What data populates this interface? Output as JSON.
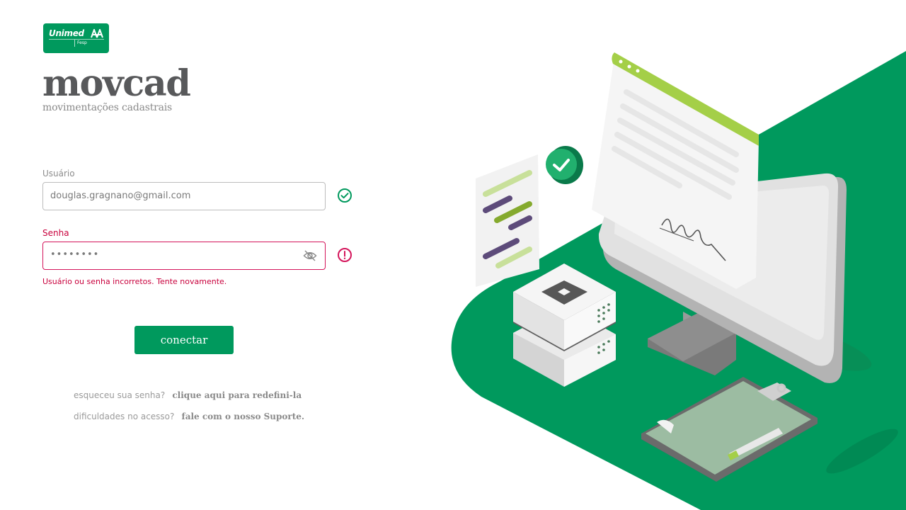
{
  "logo": {
    "brand": "Unimed",
    "region": "Fesp"
  },
  "app": {
    "name": "movcad",
    "tagline": "movimentações cadastrais"
  },
  "form": {
    "user_label": "Usuário",
    "user_value": "douglas.gragnano@gmail.com",
    "password_label": "Senha",
    "password_value": "••••••••",
    "error_message": "Usuário ou senha incorretos. Tente novamente.",
    "submit_label": "conectar"
  },
  "help": {
    "forgot_question": "esqueceu sua senha?",
    "forgot_link": "clique aqui para redefini-la",
    "support_question": "dificuldades no acesso?",
    "support_link": "fale com o nosso Suporte."
  },
  "icons": {
    "user_status": "check-circle-icon",
    "password_status": "alert-circle-icon",
    "password_toggle": "eye-off-icon"
  },
  "colors": {
    "brand_green": "#00995d",
    "error": "#c8003c",
    "success": "#00995d",
    "text_gray": "#58595b"
  }
}
